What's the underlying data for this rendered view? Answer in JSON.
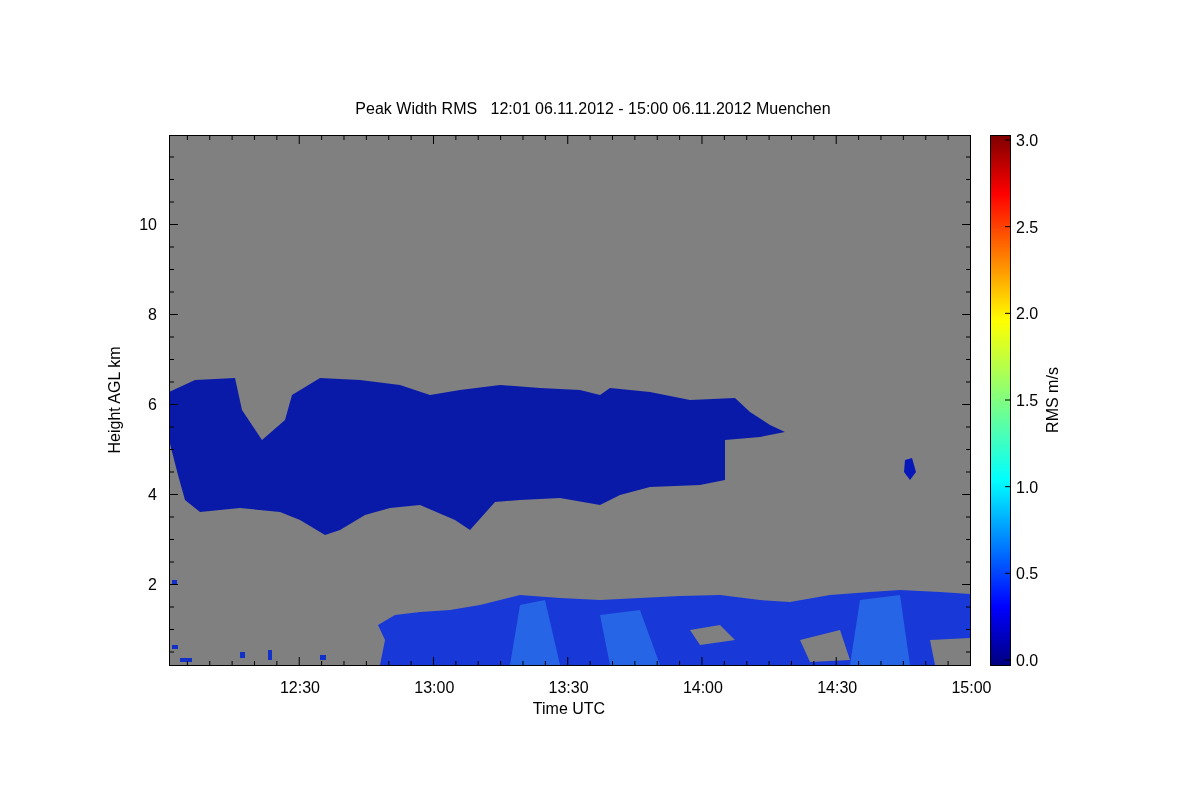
{
  "title": "Peak Width RMS   12:01 06.11.2012 - 15:00 06.11.2012 Muenchen",
  "plot": {
    "xlabel": "Time UTC",
    "ylabel": "Height AGL km",
    "xticks": [
      "12:30",
      "13:00",
      "13:30",
      "14:00",
      "14:30",
      "15:00"
    ],
    "yticks": [
      "10",
      "8",
      "6",
      "4",
      "2"
    ]
  },
  "colorbar": {
    "label": "RMS m/s",
    "ticks": [
      "3.0",
      "2.5",
      "2.0",
      "1.5",
      "1.0",
      "0.5",
      "0.0"
    ]
  }
}
